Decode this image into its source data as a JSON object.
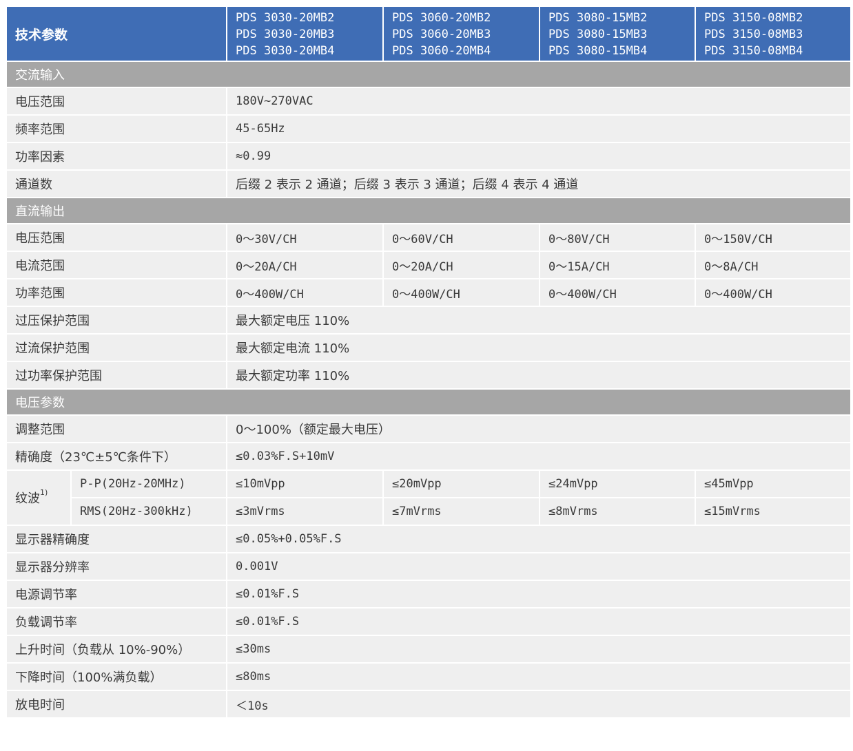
{
  "header": {
    "label": "技术参数",
    "models": [
      [
        "PDS 3030-20MB2",
        "PDS 3030-20MB3",
        "PDS 3030-20MB4"
      ],
      [
        "PDS 3060-20MB2",
        "PDS 3060-20MB3",
        "PDS 3060-20MB4"
      ],
      [
        "PDS 3080-15MB2",
        "PDS 3080-15MB3",
        "PDS 3080-15MB4"
      ],
      [
        "PDS 3150-08MB2",
        "PDS 3150-08MB3",
        "PDS 3150-08MB4"
      ]
    ]
  },
  "ac_input": {
    "title": "交流输入",
    "rows": [
      {
        "label": "电压范围",
        "value": "180V~270VAC"
      },
      {
        "label": "频率范围",
        "value": "45-65Hz"
      },
      {
        "label": "功率因素",
        "value": "≈0.99"
      },
      {
        "label": "通道数",
        "value": "后缀 2 表示 2 通道；后缀 3 表示 3 通道；后缀 4 表示 4 通道"
      }
    ]
  },
  "dc_output": {
    "title": "直流输出",
    "rows4": [
      {
        "label": "电压范围",
        "values": [
          "0～30V/CH",
          "0～60V/CH",
          "0～80V/CH",
          "0～150V/CH"
        ]
      },
      {
        "label": "电流范围",
        "values": [
          "0～20A/CH",
          "0～20A/CH",
          "0～15A/CH",
          "0～8A/CH"
        ]
      },
      {
        "label": "功率范围",
        "values": [
          "0～400W/CH",
          "0～400W/CH",
          "0～400W/CH",
          "0～400W/CH"
        ]
      }
    ],
    "rows": [
      {
        "label": "过压保护范围",
        "value": "最大额定电压 110%"
      },
      {
        "label": "过流保护范围",
        "value": "最大额定电流 110%"
      },
      {
        "label": "过功率保护范围",
        "value": "最大额定功率 110%"
      }
    ]
  },
  "voltage_params": {
    "title": "电压参数",
    "rows_top": [
      {
        "label": "调整范围",
        "value": "0～100%（额定最大电压）"
      },
      {
        "label": "精确度（23℃±5℃条件下）",
        "value": "≤0.03%F.S+10mV"
      }
    ],
    "ripple": {
      "label": "纹波",
      "note": "1)",
      "rows": [
        {
          "label": "P-P(20Hz-20MHz)",
          "values": [
            "≤10mVpp",
            "≤20mVpp",
            "≤24mVpp",
            "≤45mVpp"
          ]
        },
        {
          "label": "RMS(20Hz-300kHz)",
          "values": [
            "≤3mVrms",
            "≤7mVrms",
            "≤8mVrms",
            "≤15mVrms"
          ]
        }
      ]
    },
    "rows_bottom": [
      {
        "label": "显示器精确度",
        "value": "≤0.05%+0.05%F.S"
      },
      {
        "label": "显示器分辨率",
        "value": "0.001V"
      },
      {
        "label": "电源调节率",
        "value": "≤0.01%F.S"
      },
      {
        "label": "负载调节率",
        "value": "≤0.01%F.S"
      },
      {
        "label": "上升时间（负载从 10%-90%）",
        "value": "≤30ms"
      },
      {
        "label": "下降时间（100%满负载）",
        "value": "≤80ms"
      },
      {
        "label": "放电时间",
        "value": "＜10s"
      }
    ]
  }
}
